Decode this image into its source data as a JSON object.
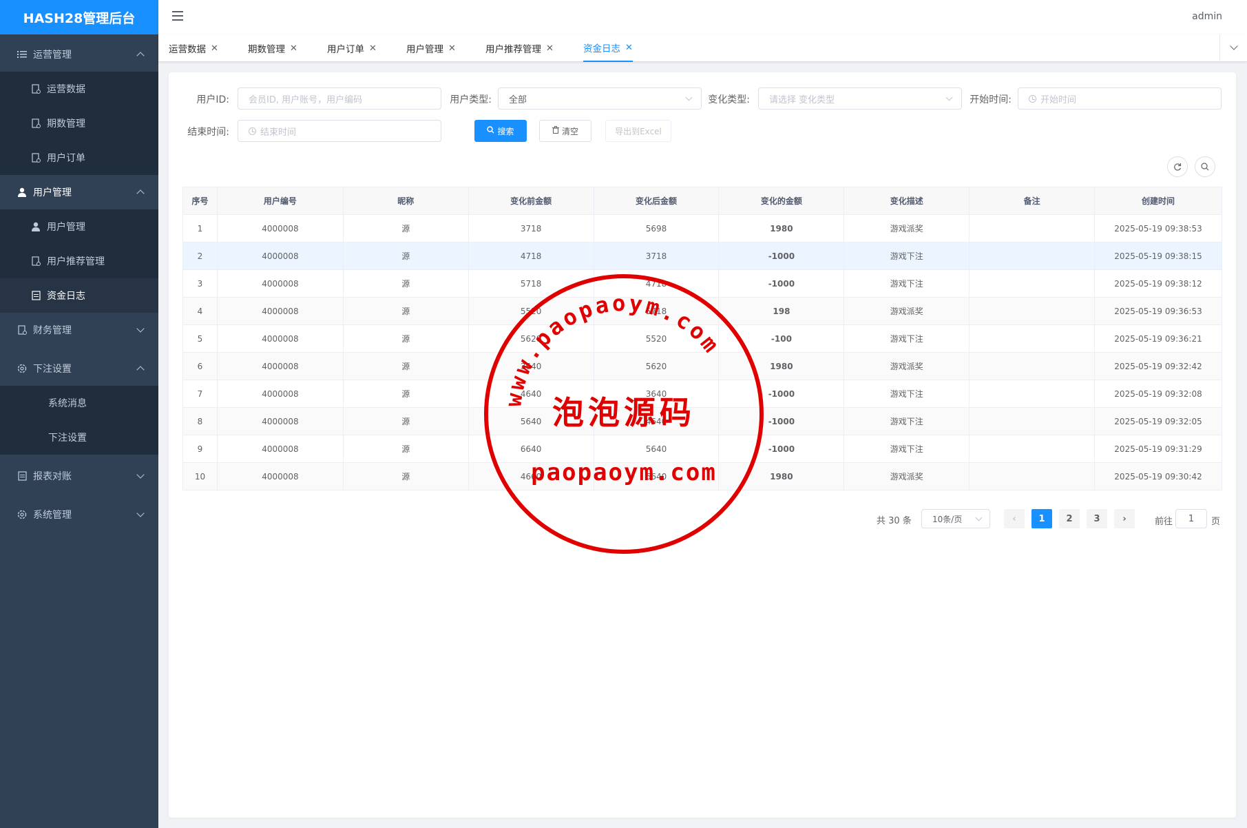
{
  "app": {
    "title": "HASH28管理后台"
  },
  "header": {
    "user": "admin"
  },
  "sidebar": {
    "groups": [
      {
        "label": "运营管理",
        "items": [
          "运营数据",
          "期数管理",
          "用户订单"
        ]
      },
      {
        "label": "用户管理",
        "items": [
          "用户管理",
          "用户推荐管理",
          "资金日志"
        ]
      },
      {
        "label": "财务管理"
      },
      {
        "label": "下注设置",
        "items": [
          "系统消息",
          "下注设置"
        ]
      },
      {
        "label": "报表对账"
      },
      {
        "label": "系统管理"
      }
    ]
  },
  "tabs": [
    "运营数据",
    "期数管理",
    "用户订单",
    "用户管理",
    "用户推荐管理",
    "资金日志"
  ],
  "filters": {
    "user_id_label": "用户ID:",
    "user_id_placeholder": "会员ID, 用户账号，用户编码",
    "user_type_label": "用户类型:",
    "user_type_value": "全部",
    "change_type_label": "变化类型:",
    "change_type_placeholder": "请选择 变化类型",
    "start_label": "开始时间:",
    "start_placeholder": "开始时间",
    "end_label": "结束时间:",
    "end_placeholder": "结束时间",
    "search_btn": "搜索",
    "clear_btn": "清空",
    "export_btn": "导出到Excel"
  },
  "table": {
    "headers": [
      "序号",
      "用户编号",
      "昵称",
      "变化前金额",
      "变化后金额",
      "变化的金额",
      "变化描述",
      "备注",
      "创建时间"
    ],
    "rows": [
      [
        "1",
        "4000008",
        "源",
        "3718",
        "5698",
        "1980",
        "游戏派奖",
        "",
        "2025-05-19 09:38:53"
      ],
      [
        "2",
        "4000008",
        "源",
        "4718",
        "3718",
        "-1000",
        "游戏下注",
        "",
        "2025-05-19 09:38:15"
      ],
      [
        "3",
        "4000008",
        "源",
        "5718",
        "4718",
        "-1000",
        "游戏下注",
        "",
        "2025-05-19 09:38:12"
      ],
      [
        "4",
        "4000008",
        "源",
        "5520",
        "5718",
        "198",
        "游戏派奖",
        "",
        "2025-05-19 09:36:53"
      ],
      [
        "5",
        "4000008",
        "源",
        "5620",
        "5520",
        "-100",
        "游戏下注",
        "",
        "2025-05-19 09:36:21"
      ],
      [
        "6",
        "4000008",
        "源",
        "3640",
        "5620",
        "1980",
        "游戏派奖",
        "",
        "2025-05-19 09:32:42"
      ],
      [
        "7",
        "4000008",
        "源",
        "4640",
        "3640",
        "-1000",
        "游戏下注",
        "",
        "2025-05-19 09:32:08"
      ],
      [
        "8",
        "4000008",
        "源",
        "5640",
        "4640",
        "-1000",
        "游戏下注",
        "",
        "2025-05-19 09:32:05"
      ],
      [
        "9",
        "4000008",
        "源",
        "6640",
        "5640",
        "-1000",
        "游戏下注",
        "",
        "2025-05-19 09:31:29"
      ],
      [
        "10",
        "4000008",
        "源",
        "4660",
        "6640",
        "1980",
        "游戏派奖",
        "",
        "2025-05-19 09:30:42"
      ]
    ]
  },
  "pagination": {
    "total": "共 30 条",
    "page_size": "10条/页",
    "pages": [
      "1",
      "2",
      "3"
    ],
    "current": "1",
    "goto_label": "前往",
    "goto_value": "1",
    "goto_suffix": "页"
  },
  "watermark": {
    "arc_text": "www.paopaoym.com",
    "center_text": "泡泡源码",
    "bottom_text": "paopaoym.com",
    "color": "#e00000"
  },
  "colors": {
    "accent": "#1890ff",
    "sidebar_bg": "#304156",
    "positive": "#e00000",
    "negative": "#13a35b"
  }
}
